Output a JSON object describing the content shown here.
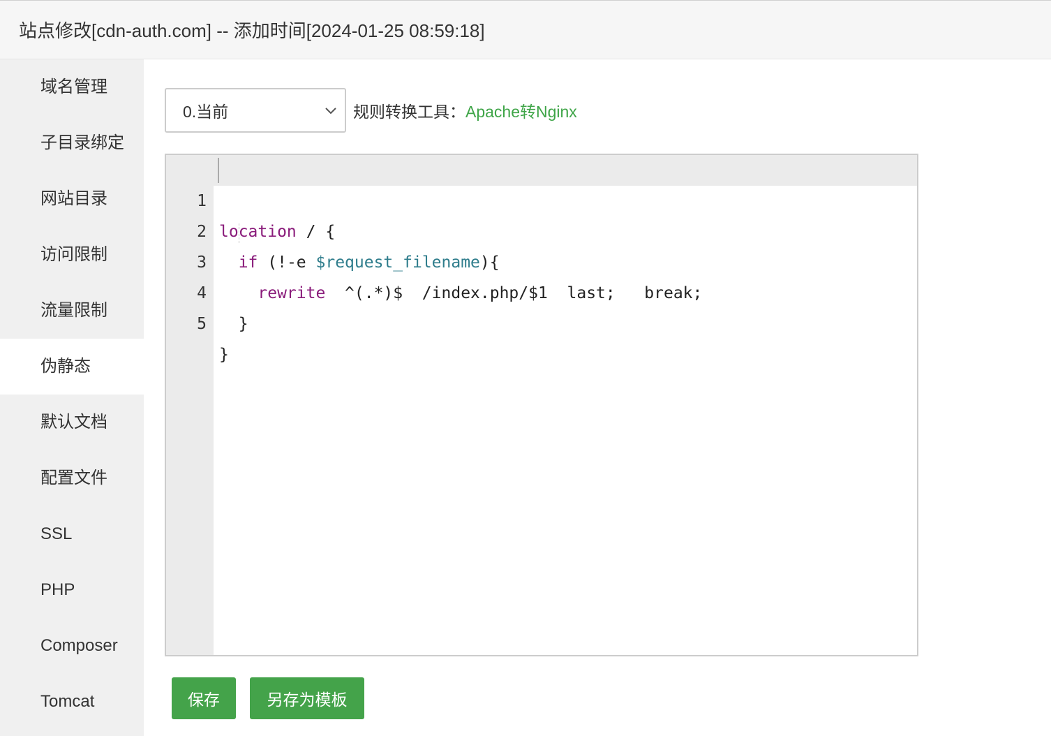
{
  "window": {
    "title": "站点修改[cdn-auth.com] -- 添加时间[2024-01-25 08:59:18]"
  },
  "sidebar": {
    "items": [
      {
        "label": "域名管理"
      },
      {
        "label": "子目录绑定"
      },
      {
        "label": "网站目录"
      },
      {
        "label": "访问限制"
      },
      {
        "label": "流量限制"
      },
      {
        "label": "伪静态",
        "active": true
      },
      {
        "label": "默认文档"
      },
      {
        "label": "配置文件"
      },
      {
        "label": "SSL"
      },
      {
        "label": "PHP"
      },
      {
        "label": "Composer"
      },
      {
        "label": "Tomcat"
      }
    ]
  },
  "toolbar": {
    "rule_select": {
      "value": "0.当前"
    },
    "converter_label": "规则转换工具：",
    "converter_link": "Apache转Nginx"
  },
  "editor": {
    "line_numbers": [
      "1",
      "2",
      "3",
      "4",
      "5"
    ],
    "lines": [
      {
        "kw": "location",
        "rest": " / {"
      },
      {
        "indent": "  ",
        "kw": "if",
        "mid": " (!-e ",
        "var": "$request_filename",
        "rest": "){"
      },
      {
        "indent": "    ",
        "kw": "rewrite",
        "rest": "  ^(.*)$  /index.php/$1  last;   break;"
      },
      {
        "indent": "  ",
        "rest": "}"
      },
      {
        "rest": "}"
      }
    ]
  },
  "buttons": {
    "save": "保存",
    "save_as_template": "另存为模板"
  },
  "colors": {
    "accent_green": "#44a34a",
    "link_green": "#3fa548",
    "keyword_purple": "#8a1c7b",
    "variable_teal": "#2f7d8c"
  }
}
